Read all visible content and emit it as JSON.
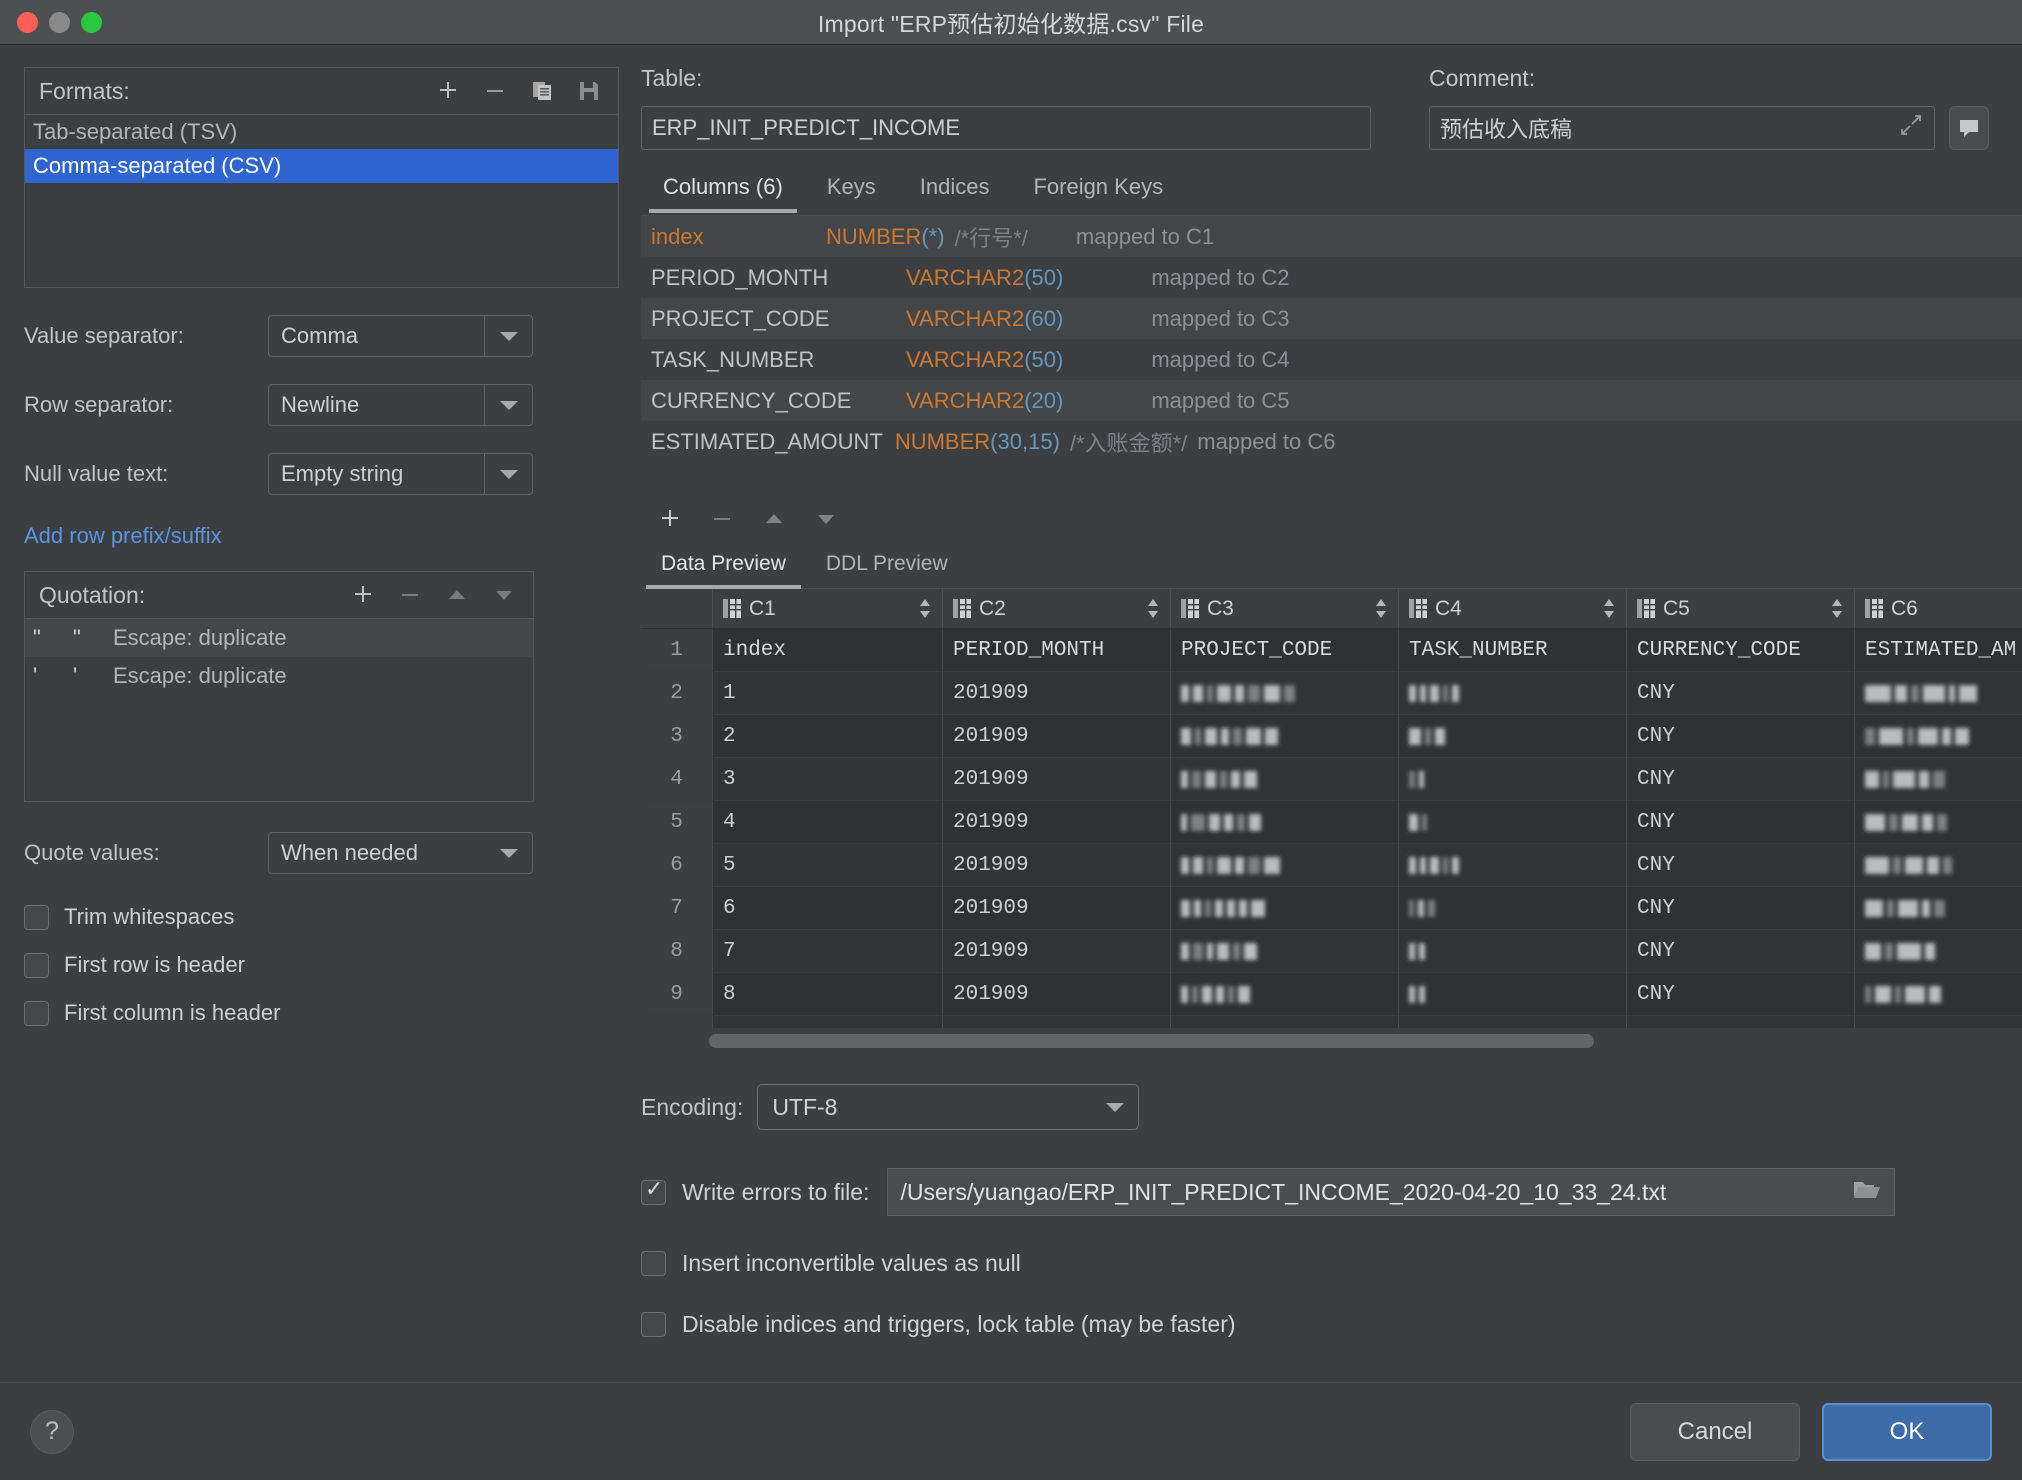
{
  "window": {
    "title": "Import \"ERP预估初始化数据.csv\" File"
  },
  "formats": {
    "label": "Formats:",
    "tools": [
      "add-icon",
      "remove-icon",
      "copy-icon",
      "save-icon"
    ],
    "items": [
      {
        "label": "Tab-separated (TSV)",
        "selected": false
      },
      {
        "label": "Comma-separated (CSV)",
        "selected": true
      }
    ]
  },
  "settings": {
    "value_separator": {
      "label": "Value separator:",
      "value": "Comma"
    },
    "row_separator": {
      "label": "Row separator:",
      "value": "Newline"
    },
    "null_value_text": {
      "label": "Null value text:",
      "value": "Empty string"
    },
    "add_row_prefix_link": "Add row prefix/suffix",
    "quote_values": {
      "label": "Quote values:",
      "value": "When needed"
    }
  },
  "quotation": {
    "label": "Quotation:",
    "tools": [
      "add-icon",
      "remove-icon",
      "move-up-icon",
      "move-down-icon"
    ],
    "items": [
      {
        "open": "\"",
        "close": "\"",
        "escape": "Escape: duplicate"
      },
      {
        "open": "'",
        "close": "'",
        "escape": "Escape: duplicate"
      }
    ]
  },
  "left_checkboxes": [
    {
      "label": "Trim whitespaces",
      "checked": false
    },
    {
      "label": "First row is header",
      "checked": false
    },
    {
      "label": "First column is header",
      "checked": false
    }
  ],
  "table": {
    "label": "Table:",
    "value": "ERP_INIT_PREDICT_INCOME"
  },
  "comment": {
    "label": "Comment:",
    "value": "预估收入底稿"
  },
  "schema_tabs": [
    {
      "label": "Columns (6)",
      "active": true
    },
    {
      "label": "Keys",
      "active": false
    },
    {
      "label": "Indices",
      "active": false
    },
    {
      "label": "Foreign Keys",
      "active": false
    }
  ],
  "columns": [
    {
      "name": "index",
      "name_accent": true,
      "type": "NUMBER",
      "args": "*",
      "comment": "/*行号*/",
      "mapped": "mapped to C1",
      "name_w": 200,
      "type_w": 0,
      "gap_after_type": 24
    },
    {
      "name": "PERIOD_MONTH",
      "name_accent": false,
      "type": "VARCHAR2",
      "args": "50",
      "comment": "",
      "mapped": "mapped to C2",
      "name_w": 250,
      "type_w": 0,
      "gap_after_type": 90
    },
    {
      "name": "PROJECT_CODE",
      "name_accent": false,
      "type": "VARCHAR2",
      "args": "60",
      "comment": "",
      "mapped": "mapped to C3",
      "name_w": 250,
      "type_w": 0,
      "gap_after_type": 90
    },
    {
      "name": "TASK_NUMBER",
      "name_accent": false,
      "type": "VARCHAR2",
      "args": "50",
      "comment": "",
      "mapped": "mapped to C4",
      "name_w": 250,
      "type_w": 0,
      "gap_after_type": 90
    },
    {
      "name": "CURRENCY_CODE",
      "name_accent": false,
      "type": "VARCHAR2",
      "args": "20",
      "comment": "",
      "mapped": "mapped to C5",
      "name_w": 250,
      "type_w": 0,
      "gap_after_type": 90
    },
    {
      "name": "ESTIMATED_AMOUNT",
      "name_accent": false,
      "type": "NUMBER",
      "args": "30,15",
      "comment": "/*入账金额*/",
      "mapped": "mapped to C6",
      "name_w": 250,
      "type_w": 0,
      "gap_after_type": 10
    }
  ],
  "column_tools": [
    "add-icon",
    "remove-icon",
    "move-up-icon",
    "move-down-icon"
  ],
  "preview_tabs": [
    {
      "label": "Data Preview",
      "active": true
    },
    {
      "label": "DDL Preview",
      "active": false
    }
  ],
  "preview_grid": {
    "columns": [
      "C1",
      "C2",
      "C3",
      "C4",
      "C5",
      "C6"
    ],
    "rows": [
      {
        "n": "1",
        "cells": [
          "index",
          "PERIOD_MONTH",
          "PROJECT_CODE",
          "TASK_NUMBER",
          "CURRENCY_CODE",
          "ESTIMATED_AM"
        ],
        "redacted": []
      },
      {
        "n": "2",
        "cells": [
          "1",
          "201909",
          "",
          "",
          "CNY",
          ""
        ],
        "redacted": [
          2,
          3,
          5
        ]
      },
      {
        "n": "3",
        "cells": [
          "2",
          "201909",
          "",
          "",
          "CNY",
          ""
        ],
        "redacted": [
          2,
          3,
          5
        ]
      },
      {
        "n": "4",
        "cells": [
          "3",
          "201909",
          "",
          "",
          "CNY",
          ""
        ],
        "redacted": [
          2,
          3,
          5
        ]
      },
      {
        "n": "5",
        "cells": [
          "4",
          "201909",
          "",
          "",
          "CNY",
          ""
        ],
        "redacted": [
          2,
          3,
          5
        ]
      },
      {
        "n": "6",
        "cells": [
          "5",
          "201909",
          "",
          "",
          "CNY",
          ""
        ],
        "redacted": [
          2,
          3,
          5
        ]
      },
      {
        "n": "7",
        "cells": [
          "6",
          "201909",
          "",
          "",
          "CNY",
          ""
        ],
        "redacted": [
          2,
          3,
          5
        ]
      },
      {
        "n": "8",
        "cells": [
          "7",
          "201909",
          "",
          "",
          "CNY",
          ""
        ],
        "redacted": [
          2,
          3,
          5
        ]
      },
      {
        "n": "9",
        "cells": [
          "8",
          "201909",
          "",
          "",
          "CNY",
          ""
        ],
        "redacted": [
          2,
          3,
          5
        ]
      }
    ]
  },
  "encoding": {
    "label": "Encoding:",
    "value": "UTF-8"
  },
  "bottom_options": [
    {
      "label": "Write errors to file:",
      "checked": true
    },
    {
      "label": "Insert inconvertible values as null",
      "checked": false
    },
    {
      "label": "Disable indices and triggers, lock table (may be faster)",
      "checked": false
    }
  ],
  "error_file_path": "/Users/yuangao/ERP_INIT_PREDICT_INCOME_2020-04-20_10_33_24.txt",
  "footer": {
    "help": "?",
    "cancel": "Cancel",
    "ok": "OK"
  },
  "colors": {
    "accent_selection": "#2f65d0",
    "keyword_orange": "#cc7832",
    "number_blue": "#6897bb",
    "link_blue": "#5c93e0",
    "ok_button": "#3e6ca8",
    "window_bg": "#3c3f41"
  }
}
